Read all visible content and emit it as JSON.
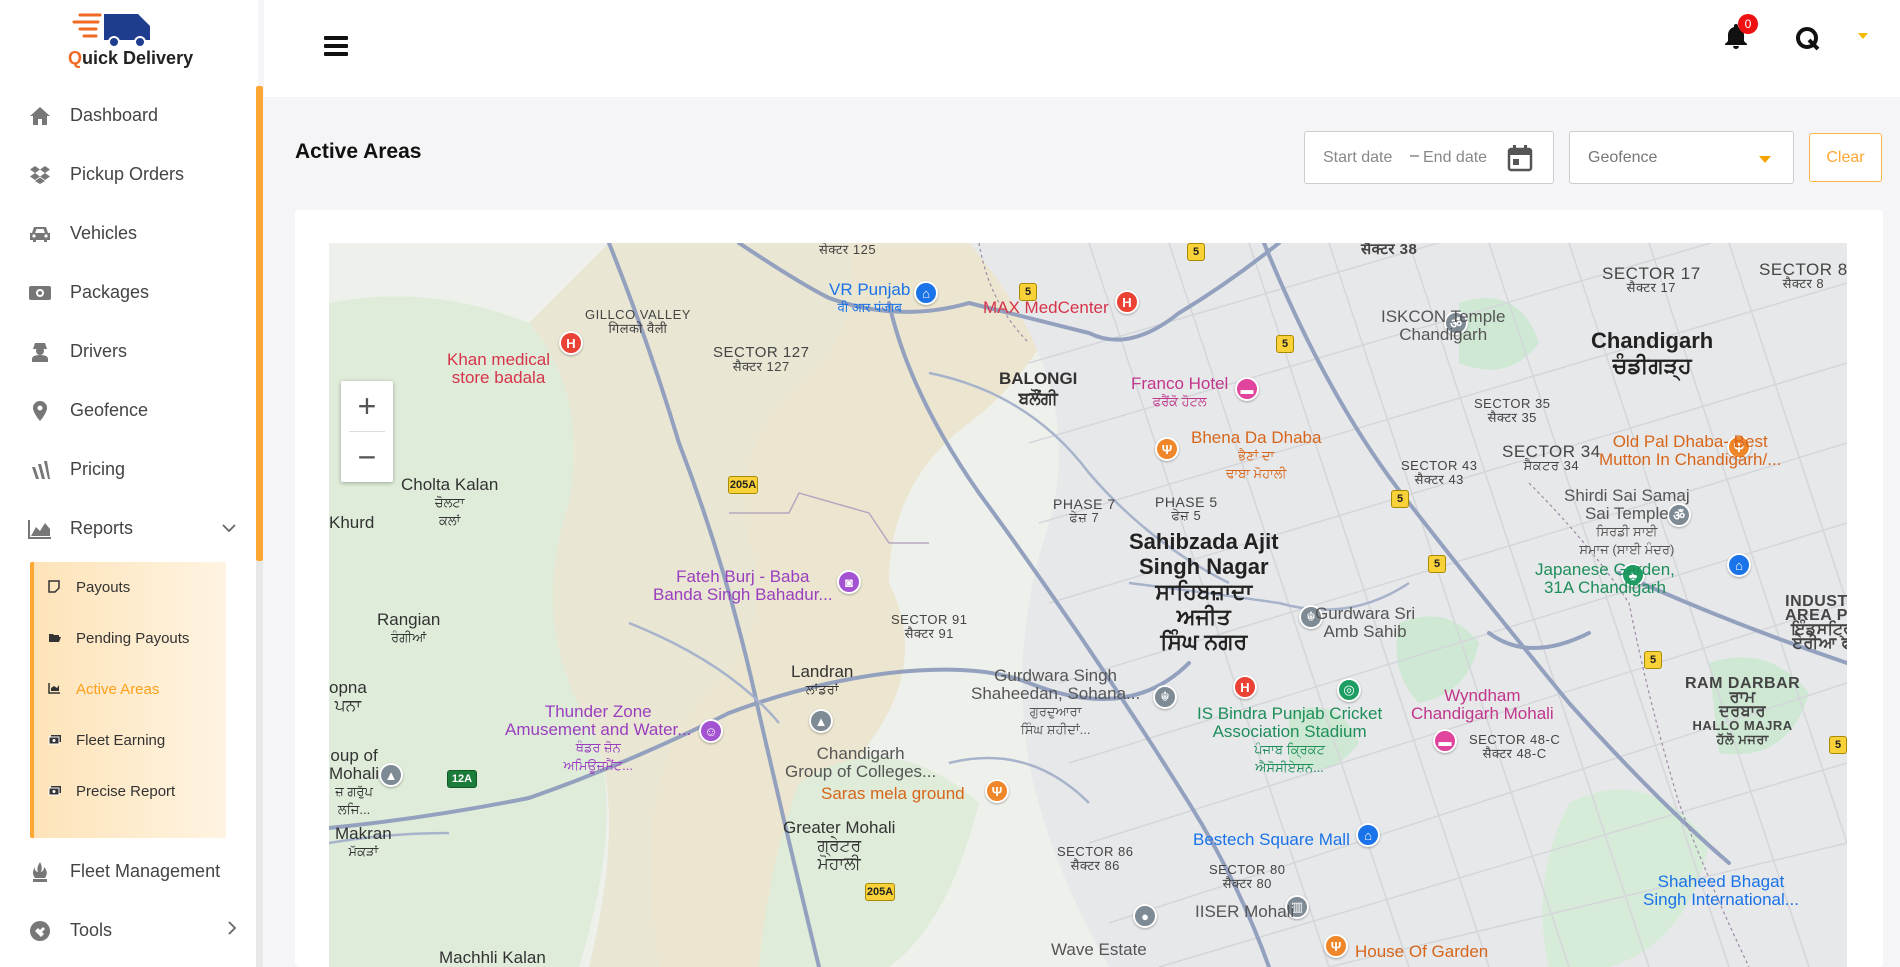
{
  "app": {
    "logo_text_q": "Q",
    "logo_text_rest": "uick Delivery"
  },
  "sidebar": {
    "items": [
      {
        "label": "Dashboard",
        "icon": "home-icon"
      },
      {
        "label": "Pickup Orders",
        "icon": "dropbox-icon"
      },
      {
        "label": "Vehicles",
        "icon": "car-icon"
      },
      {
        "label": "Packages",
        "icon": "money-icon"
      },
      {
        "label": "Drivers",
        "icon": "driver-icon"
      },
      {
        "label": "Geofence",
        "icon": "location-pin-icon"
      },
      {
        "label": "Pricing",
        "icon": "pricing-icon"
      },
      {
        "label": "Reports",
        "icon": "area-chart-icon"
      },
      {
        "label": "Fleet Management",
        "icon": "fleet-icon"
      },
      {
        "label": "Tools",
        "icon": "tools-icon"
      }
    ],
    "reports_submenu": [
      {
        "label": "Payouts",
        "icon": "note-icon"
      },
      {
        "label": "Pending Payouts",
        "icon": "folder-open-icon"
      },
      {
        "label": "Active Areas",
        "icon": "line-chart-icon",
        "active": true
      },
      {
        "label": "Fleet Earning",
        "icon": "cash-icon"
      },
      {
        "label": "Precise Report",
        "icon": "cash-icon"
      }
    ]
  },
  "header": {
    "notification_count": "0"
  },
  "page": {
    "title": "Active Areas",
    "start_date_placeholder": "Start date",
    "date_separator": "–",
    "end_date_placeholder": "End date",
    "geofence_placeholder": "Geofence",
    "clear_label": "Clear"
  },
  "map": {
    "zoom_in": "+",
    "zoom_out": "−",
    "labels": {
      "sector125": "सेक्टर 125",
      "vr_punjab": "VR Punjab",
      "vr_punjab_pa": "वी आर पंजाब",
      "max": "MAX MedCenter",
      "sector38": "सैक्टर 38",
      "sector17": "SECTOR 17",
      "sector17_pa": "सैक्टर 17",
      "sector8": "SECTOR 8",
      "sector8_pa": "सैक्टर 8",
      "gillco": "GILLCO VALLEY",
      "gillco_pa": "गिलको वैली",
      "sector127": "SECTOR 127",
      "sector127_pa": "सैक्टर 127",
      "iskcon": "ISKCON Temple",
      "iskcon2": "Chandigarh",
      "chandigarh": "Chandigarh",
      "chandigarh_pa": "ਚੰਡੀਗੜ੍ਹ",
      "khan1": "Khan medical",
      "khan2": "store badala",
      "balongi": "BALONGI",
      "balongi_pa": "ਬਲੌਂਗੀ",
      "franco": "Franco Hotel",
      "franco_pa": "ਫਰੈਂਕੋ ਹੋਟਲ",
      "sector35": "SECTOR 35",
      "sector35_pa": "सैक्टर 35",
      "bhena1": "Bhena Da Dhaba",
      "bhena2": "ਭੈਣਾਂ ਦਾ",
      "bhena3": "ਢਾਬਾ ਮੋਹਾਲੀ",
      "oldpal1": "Old Pal Dhaba- Best",
      "oldpal2": "Mutton In Chandigarh/...",
      "sector34": "SECTOR 34",
      "sector34_pa": "ਸੈਕਟਰ 34",
      "sector43": "SECTOR 43",
      "sector43_pa": "सैक्टर 43",
      "cholta": "Cholta Kalan",
      "cholta_pa": "ਚੋਲਟਾ",
      "cholta_pa2": "ਕਲਾਂ",
      "phase7": "PHASE 7",
      "phase7_pa": "ਫੇਜ਼ 7",
      "phase5": "PHASE 5",
      "phase5_pa": "ਫੇਜ਼ 5",
      "shirdi1": "Shirdi Sai Samaj",
      "shirdi2": "Sai Temple",
      "shirdi3": "ਸਿਰਡੀ ਸਾਈ",
      "shirdi4": "ਸਮਾਜ (ਸਾਈ ਮੰਦਰ)",
      "khurd": "Khurd",
      "sas1": "Sahibzada Ajit",
      "sas2": "Singh Nagar",
      "sas3": "ਸਾਹਿਬਜ਼ਾਦਾ",
      "sas4": "ਅਜੀਤ",
      "sas5": "ਸਿੰਘ ਨਗਰ",
      "japanese1": "Japanese Garden,",
      "japanese2": "31A Chandigarh",
      "fateh1": "Fateh Burj - Baba",
      "fateh2": "Banda Singh Bahadur...",
      "industrial1": "INDUSTR",
      "industrial2": "AREA PH",
      "industrial3": "ਇੰਡਸਟ੍ਰਿ",
      "industrial4": "ਏਰੀਆ ਫ",
      "rangian": "Rangian",
      "rangian_pa": "ਰੰਗੀਆਂ",
      "sector91": "SECTOR 91",
      "sector91_pa": "सैक्टर 91",
      "gurdwara_amb1": "Gurdwara Sri",
      "gurdwara_amb2": "Amb Sahib",
      "landran": "Landran",
      "landran_pa": "ਲਾਂਡਰਾਂ",
      "gurdwara_sh1": "Gurdwara Singh",
      "gurdwara_sh2": "Shaheedan, Sohana...",
      "gurdwara_sh3": "ਗੁਰਦੁਆਰਾ",
      "gurdwara_sh4": "ਸਿੰਘ ਸ਼ਹੀਦਾਂ...",
      "wyndham1": "Wyndham",
      "wyndham2": "Chandigarh Mohali",
      "ramdarbar": "RAM DARBAR",
      "ramdarbar_pa": "ਰਾਮ",
      "ramdarbar_pa2": "ਦਰਬਾਰ",
      "hallomajra": "HALLO MAJRA",
      "hallomajra_pa": "ਹੱਲੋ ਮਜਰਾ",
      "opna": "opna",
      "opna_pa": "ਪਨਾ",
      "thunder1": "Thunder Zone",
      "thunder2": "Amusement and Water...",
      "thunder3": "ਥੰਡਰ ਜ਼ੋਨ",
      "thunder4": "ਅਮਿਊਜ਼ਮੈਂਟ...",
      "bindra1": "IS Bindra Punjab Cricket",
      "bindra2": "Association Stadium",
      "bindra3": "ਪੰਜਾਬ ਕ੍ਰਿਕਟ",
      "bindra4": "ਐਸੋਸੀਏਸ਼ਨ...",
      "sector48c": "SECTOR 48-C",
      "sector48c_pa": "सैक्टर 48-C",
      "cgc1": "Chandigarh",
      "cgc2": "Group of Colleges...",
      "groupof1": "oup of",
      "groupof2": "Mohali",
      "groupof3": "ਜ਼ ਗਰੁੱਪ",
      "groupof4": "ਲਜਿ...",
      "saras": "Saras mela ground",
      "shaheed1": "Shaheed Bhagat",
      "shaheed2": "Singh International...",
      "makran": "Makran",
      "makran_pa": "ਮੱਕੜਾਂ",
      "greater1": "Greater Mohali",
      "greater2": "ਗ੍ਰੇਟਰ",
      "greater3": "ਮੋਹਾਲੀ",
      "sector86": "SECTOR 86",
      "sector86_pa": "सैक्टर 86",
      "bestech": "Bestech Square Mall",
      "sector80": "SECTOR 80",
      "sector80_pa": "सैक्टर 80",
      "iiser": "IISER Mohali",
      "wave": "Wave Estate",
      "houseofgarden": "House Of Garden",
      "machhli": "Machhli Kalan"
    },
    "road_shields": [
      "5",
      "5",
      "5",
      "5",
      "5",
      "5",
      "5",
      "205A",
      "205A",
      "12A"
    ],
    "colors": {
      "road": "#8e9cb8",
      "water_green": "#cfe8d3",
      "tan": "#ebe3cc",
      "urban": "#e8e8ea"
    }
  }
}
